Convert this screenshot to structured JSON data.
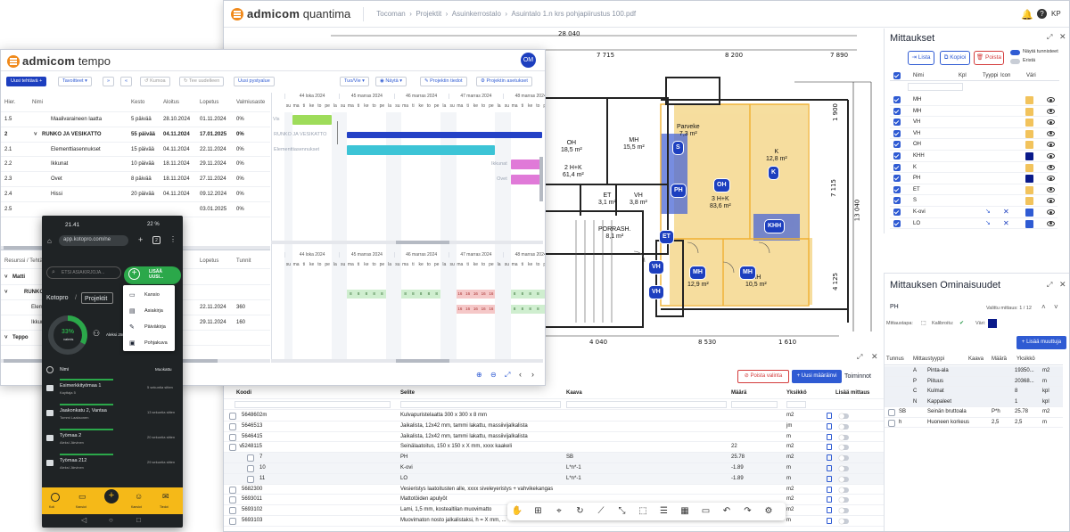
{
  "quantima": {
    "brand": "admicom",
    "product": "quantima",
    "breadcrumb": [
      "Tocoman",
      "Projektit",
      "Asuinkerrostalo",
      "Asuintalo 1.n krs pohjapiirustus 100.pdf"
    ],
    "user_initials": "KP",
    "plan": {
      "dims_top": [
        "28 040",
        "7 715",
        "8 200",
        "7 890"
      ],
      "dims_right": [
        "1 900",
        "7 115",
        "13 040",
        "4 125"
      ],
      "dims_bottom": [
        "4 040",
        "8 530",
        "1 610"
      ],
      "rooms": [
        {
          "key": "r1",
          "lines": [
            "OH",
            "18,5 m²"
          ]
        },
        {
          "key": "r2",
          "lines": [
            "MH",
            "15,5 m²"
          ]
        },
        {
          "key": "r3",
          "lines": [
            "2 H+K",
            "61,4 m²"
          ]
        },
        {
          "key": "r4",
          "lines": [
            "PORRASH.",
            "8,1 m²"
          ]
        },
        {
          "key": "r5",
          "lines": [
            "Parveke",
            "7,3 m²"
          ]
        },
        {
          "key": "r6",
          "lines": [
            "3 H+K",
            "83,6 m²"
          ]
        },
        {
          "key": "r7",
          "lines": [
            "K",
            "12,8 m²"
          ]
        },
        {
          "key": "r8",
          "lines": [
            "MH",
            "12,9 m²"
          ]
        },
        {
          "key": "r9",
          "lines": [
            "MH",
            "10,5 m²"
          ]
        },
        {
          "key": "r10",
          "lines": [
            "ET",
            "3,1 m²"
          ]
        },
        {
          "key": "r11",
          "lines": [
            "VH",
            "3,8 m²"
          ]
        }
      ],
      "markers": [
        "S",
        "PH",
        "OH",
        "K",
        "ET",
        "KHH",
        "VH",
        "MH",
        "MH",
        "VH"
      ]
    },
    "mittaukset": {
      "title": "Mittaukset",
      "btn_list": "Lista",
      "btn_copy": "Kopioi",
      "btn_delete": "Poista",
      "toggle_show_ids": "Näytä tunnisteet",
      "toggle_isolate": "Eristä",
      "columns": {
        "name": "Nimi",
        "count": "Kpl",
        "type": "Tyyppi",
        "icon": "Icon",
        "color": "Väri"
      },
      "rows": [
        {
          "name": "MH",
          "color": "#f2c35c",
          "type": "",
          "icon": ""
        },
        {
          "name": "MH",
          "color": "#f2c35c",
          "type": "",
          "icon": ""
        },
        {
          "name": "VH",
          "color": "#f2c35c",
          "type": "",
          "icon": ""
        },
        {
          "name": "VH",
          "color": "#f2c35c",
          "type": "",
          "icon": ""
        },
        {
          "name": "OH",
          "color": "#f2c35c",
          "type": "",
          "icon": ""
        },
        {
          "name": "KHH",
          "color": "#0a1a8a",
          "type": "",
          "icon": ""
        },
        {
          "name": "K",
          "color": "#f2c35c",
          "type": "",
          "icon": ""
        },
        {
          "name": "PH",
          "color": "#0a1a8a",
          "type": "",
          "icon": ""
        },
        {
          "name": "ET",
          "color": "#f2c35c",
          "type": "",
          "icon": ""
        },
        {
          "name": "S",
          "color": "#f2c35c",
          "type": "",
          "icon": ""
        },
        {
          "name": "K-ovi",
          "color": "#2f5bd3",
          "type": "↘",
          "icon": "✕"
        },
        {
          "name": "LO",
          "color": "#2f5bd3",
          "type": "↘",
          "icon": "✕"
        }
      ]
    },
    "ominaisuudet": {
      "title": "Mittauksen Ominaisuudet",
      "selected": "PH",
      "selected_count": "Valittu mittaus: 1 / 12",
      "label_method": "Mittaustapa:",
      "label_calibrated": "Kalibroitu:",
      "label_color": "Väri:",
      "color": "#0a1a8a",
      "add_button": "Lisää muuttuja",
      "columns": {
        "id": "Tunnus",
        "type": "Mittaustyyppi",
        "formula": "Kaava",
        "amount": "Määrä",
        "unit": "Yksikkö"
      },
      "rows": [
        {
          "id": "A",
          "type": "Pinta-ala",
          "formula": "",
          "amount": "19350...",
          "unit": "m2"
        },
        {
          "id": "P",
          "type": "Piituus",
          "formula": "",
          "amount": "20368...",
          "unit": "m"
        },
        {
          "id": "C",
          "type": "Kulmat",
          "formula": "",
          "amount": "8",
          "unit": "kpl"
        },
        {
          "id": "N",
          "type": "Kappaleet",
          "formula": "",
          "amount": "1",
          "unit": "kpl"
        },
        {
          "id": "SB",
          "type": "Seinän bruttoala",
          "formula": "P*h",
          "amount": "25.78",
          "unit": "m2"
        },
        {
          "id": "h",
          "type": "Huoneen korkeus",
          "formula": "2,5",
          "amount": "2,5",
          "unit": "m"
        }
      ]
    },
    "table": {
      "btn_remove": "Poista valinta",
      "btn_new": "Uusi määräinvi",
      "actions": "Toiminnot",
      "columns": {
        "code": "Koodi",
        "desc": "Selite",
        "formula": "Kaava",
        "amount": "Määrä",
        "unit": "Yksikkö",
        "add": "Lisää mittaus"
      },
      "rows": [
        {
          "code": "5648602m",
          "desc": "Kulvapuristelaatta 300 x 300 x 8 mm",
          "formula": "",
          "amount": "",
          "unit": "m2",
          "level": 0
        },
        {
          "code": "5646513",
          "desc": "Jaikalista, 12x42 mm, tammi lakattu, massiivijalkalista",
          "formula": "",
          "amount": "",
          "unit": "jm",
          "level": 0
        },
        {
          "code": "5646415",
          "desc": "Jaikalista, 12x42 mm, tammi lakattu, massiivijalkalista",
          "formula": "",
          "amount": "",
          "unit": "m",
          "level": 0
        },
        {
          "code": "5248115",
          "desc": "Seinälaatoitus, 150 x 150 x X mm, xxxx kaakeli",
          "formula": "",
          "amount": "22",
          "unit": "m2",
          "level": 0
        },
        {
          "code": "7",
          "desc": "PH",
          "formula": "SB",
          "amount": "25.78",
          "unit": "m2",
          "level": 1
        },
        {
          "code": "10",
          "desc": "K-ovi",
          "formula": "L*n*-1",
          "amount": "-1.89",
          "unit": "m",
          "level": 1
        },
        {
          "code": "11",
          "desc": "LO",
          "formula": "L*n*-1",
          "amount": "-1.89",
          "unit": "m",
          "level": 1
        },
        {
          "code": "5682300",
          "desc": "Vesieristys laatoitusten alle, xxxx siveleyeristys + vahvikekangas",
          "formula": "",
          "amount": "",
          "unit": "m2",
          "level": 0
        },
        {
          "code": "5693011",
          "desc": "Mattotöiden apulyöt",
          "formula": "",
          "amount": "",
          "unit": "m2",
          "level": 0
        },
        {
          "code": "5693102",
          "desc": "Lami, 1,5 mm, kostealtilan muovimatto",
          "formula": "",
          "amount": "",
          "unit": "m2",
          "level": 0
        },
        {
          "code": "5693103",
          "desc": "Muovimaton nosto jalkalistaksi, h = X mm, ...",
          "formula": "",
          "amount": "",
          "unit": "m",
          "level": 0
        }
      ]
    },
    "toolbar_icons": [
      "hand-icon",
      "select-icon",
      "zoom-area-icon",
      "rotate-icon",
      "measure-icon",
      "fit-icon",
      "area-icon",
      "list-icon",
      "table-icon",
      "folder-icon",
      "undo-icon",
      "redo-icon",
      "settings-icon"
    ]
  },
  "tempo": {
    "brand": "admicom",
    "product": "tempo",
    "user_initials": "OM",
    "toolbar": {
      "new_task": "Uusi tehtävä",
      "favourites": "Tavoitteet",
      "cancel": "Kumoa",
      "redo": "Tee uudelleen",
      "new_row": "Uusi pystyalue",
      "io": "Tuo/Vie",
      "show": "Näytä",
      "project_info": "Projektin tiedot",
      "project_settings": "Projektin asetukset"
    },
    "columns": {
      "hier": "Hier.",
      "name": "Nimi",
      "dur": "Kesto",
      "start": "Aloitus",
      "end": "Lopetus",
      "pct": "Valmiusaste"
    },
    "tasks": [
      {
        "hier": "1.5",
        "name": "Maalivaraineen laatta",
        "dur": "5 päivää",
        "start": "28.10.2024",
        "end": "01.11.2024",
        "pct": "0%",
        "group": false,
        "bar_start": "2024-10-28",
        "bar_end": "2024-11-01",
        "color": "#9edc5a",
        "bar_label": "Vis"
      },
      {
        "hier": "2",
        "name": "RUNKO JA VESIKATTO",
        "dur": "55 päivää",
        "start": "04.11.2024",
        "end": "17.01.2025",
        "pct": "0%",
        "group": true,
        "bar_start": "2024-11-04",
        "bar_end": "2025-01-17",
        "color": "#2442c6",
        "bar_label": "RUNKO JA VESIKATTO"
      },
      {
        "hier": "2.1",
        "name": "Elementtiasennukset",
        "dur": "15 päivää",
        "start": "04.11.2024",
        "end": "22.11.2024",
        "pct": "0%",
        "group": false,
        "bar_start": "2024-11-04",
        "bar_end": "2024-11-22",
        "color": "#3cc4d6",
        "bar_label": "Elementtiasennukset"
      },
      {
        "hier": "2.2",
        "name": "Ikkunat",
        "dur": "10 päivää",
        "start": "18.11.2024",
        "end": "29.11.2024",
        "pct": "0%",
        "group": false,
        "bar_start": "2024-11-25",
        "bar_end": "2024-12-06",
        "color": "#e07ad8",
        "bar_label": "Ikkunat"
      },
      {
        "hier": "2.3",
        "name": "Ovet",
        "dur": "8 päivää",
        "start": "18.11.2024",
        "end": "27.11.2024",
        "pct": "0%",
        "group": false,
        "bar_start": "2024-11-25",
        "bar_end": "2024-12-06",
        "color": "#e07ad8",
        "bar_label": "Ovet"
      },
      {
        "hier": "2.4",
        "name": "Hissi",
        "dur": "20 päivää",
        "start": "04.11.2024",
        "end": "09.12.2024",
        "pct": "0%",
        "group": false,
        "bar_start": "2024-12-09",
        "bar_end": "2024-12-13",
        "color": "#49d6a8",
        "bar_label": "Hissi"
      },
      {
        "hier": "2.5",
        "name": "",
        "dur": "",
        "start": "",
        "end": "03.01.2025",
        "pct": "0%",
        "group": false,
        "bar_start": "",
        "bar_end": "",
        "color": "",
        "bar_label": ""
      }
    ],
    "weeks": [
      "44 loka 2024",
      "45 marras 2024",
      "46 marras 2024",
      "47 marras 2024",
      "48 marras 2024"
    ],
    "days": [
      "su",
      "ma",
      "ti",
      "ke",
      "to",
      "pe",
      "la"
    ],
    "resources_header": {
      "name": "Resurssi / Tehtävä",
      "end": "Lopetus",
      "hours": "Tunnit"
    },
    "resources": [
      {
        "name": "Matti",
        "end": "",
        "hours": "",
        "group": true
      },
      {
        "name": "RUNKO JA VESIKATTO",
        "end": "",
        "hours": "",
        "group": true
      },
      {
        "name": "Elementtiasennukset",
        "end": "22.11.2024",
        "hours": "360",
        "group": false
      },
      {
        "name": "Ikkunat",
        "end": "29.11.2024",
        "hours": "160",
        "group": false
      },
      {
        "name": "Teppo",
        "end": "",
        "hours": "",
        "group": true
      }
    ],
    "res_values": {
      "green": "8",
      "red": "16"
    }
  },
  "kotopro": {
    "status_time": "21.41",
    "status_right": "22 %",
    "url": "app.kotopro.com/ne",
    "search_placeholder": "ETSI ASIAKIRJOJA...",
    "add_button": "LISÄÄ UUSI...",
    "breadcrumb": [
      "Kotopro",
      "Projektit"
    ],
    "progress": "33%",
    "progress_label": "valmis",
    "progress_value": 0.33,
    "person": "Aleksi Järvinen",
    "menu": [
      "Kansio",
      "Asiakirja",
      "Päiväkirja",
      "Pohjakuva"
    ],
    "list_header": "Nimi",
    "sort_label": "Muokattu",
    "items": [
      {
        "name": "Esimerkkityömaa 1",
        "sub": "Kayttaja 5",
        "time": "5 sekuntia sitten"
      },
      {
        "name": "Jaakonkatu 2, Vantaa",
        "sub": "Tommi Laaksonen",
        "time": "13 sekuntia sitten"
      },
      {
        "name": "Työmaa 2",
        "sub": "Aleksi Järvinen",
        "time": "20 sekuntia sitten"
      },
      {
        "name": "Työmaa 212",
        "sub": "Aleksi Järvinen",
        "time": "29 sekuntia sitten"
      }
    ],
    "bottom_nav": [
      "Koti",
      "Kansiot",
      "",
      "Kansiot",
      "Tiedot"
    ]
  }
}
